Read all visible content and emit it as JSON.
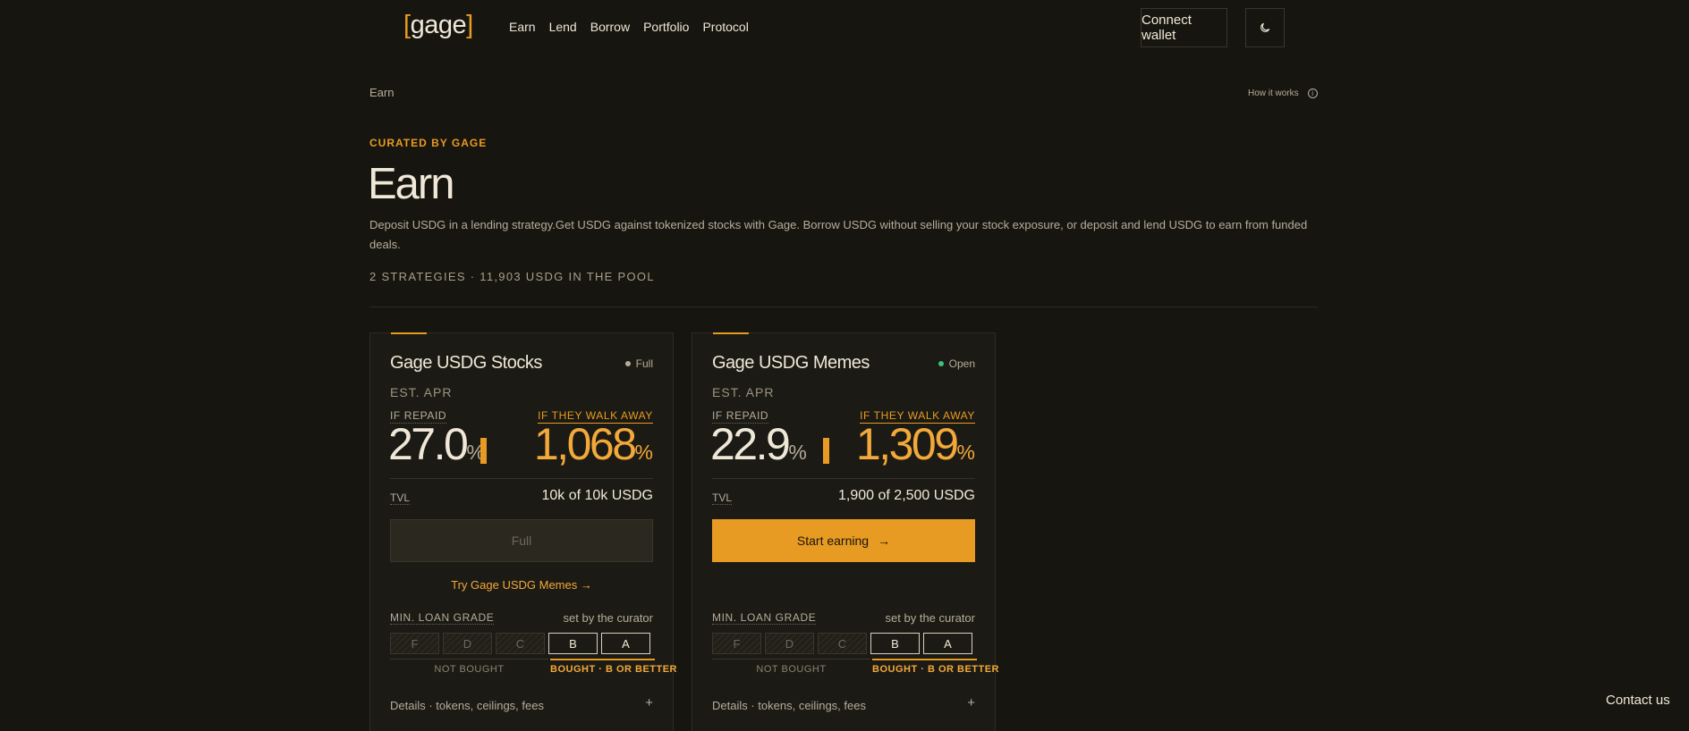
{
  "header": {
    "logo_open": "[",
    "logo_text": "gage",
    "logo_close": "]",
    "nav": [
      "Earn",
      "Lend",
      "Borrow",
      "Portfolio",
      "Protocol"
    ],
    "connect_wallet": "Connect wallet",
    "theme_icon": "moon-icon"
  },
  "breadcrumb": "Earn",
  "how_it_works": "How it works",
  "info_glyph": "i",
  "hero": {
    "eyebrow": "CURATED BY GAGE",
    "title": "Earn",
    "description": "Deposit USDG in a lending strategy.Get USDG against tokenized stocks with Gage. Borrow USDG without selling your stock exposure, or deposit and lend USDG to earn from funded deals.",
    "stats": "2 STRATEGIES · 11,903 USDG IN THE POOL"
  },
  "accent_color": "#e89b22",
  "cards": [
    {
      "name": "Gage USDG Stocks",
      "status": "Full",
      "status_color": "#b5ad9b",
      "est_apr_label": "EST. APR",
      "if_repaid_label": "IF REPAID",
      "if_repaid_value": "27.0",
      "walk_away_label": "IF THEY WALK AWAY",
      "walk_away_value": "1,068",
      "pct": "%",
      "tvl_label": "TVL",
      "tvl_value": "10k of 10k USDG",
      "button_label": "Full",
      "button_state": "disabled",
      "try_link": "Try Gage USDG Memes →",
      "min_grade_label": "MIN. LOAN GRADE",
      "set_by": "set by the curator",
      "grades": [
        "F",
        "D",
        "C",
        "B",
        "A"
      ],
      "not_bought": "NOT BOUGHT",
      "bought": "BOUGHT · B OR BETTER",
      "details": "Details · tokens, ceilings, fees",
      "expand": "+"
    },
    {
      "name": "Gage USDG Memes",
      "status": "Open",
      "status_color": "#3fbf7f",
      "est_apr_label": "EST. APR",
      "if_repaid_label": "IF REPAID",
      "if_repaid_value": "22.9",
      "walk_away_label": "IF THEY WALK AWAY",
      "walk_away_value": "1,309",
      "pct": "%",
      "tvl_label": "TVL",
      "tvl_value": "1,900 of 2,500 USDG",
      "button_label": "Start earning",
      "button_arrow": "→",
      "button_state": "primary",
      "min_grade_label": "MIN. LOAN GRADE",
      "set_by": "set by the curator",
      "grades": [
        "F",
        "D",
        "C",
        "B",
        "A"
      ],
      "not_bought": "NOT BOUGHT",
      "bought": "BOUGHT · B OR BETTER",
      "details": "Details · tokens, ceilings, fees",
      "expand": "+"
    }
  ],
  "contact": "Contact us"
}
